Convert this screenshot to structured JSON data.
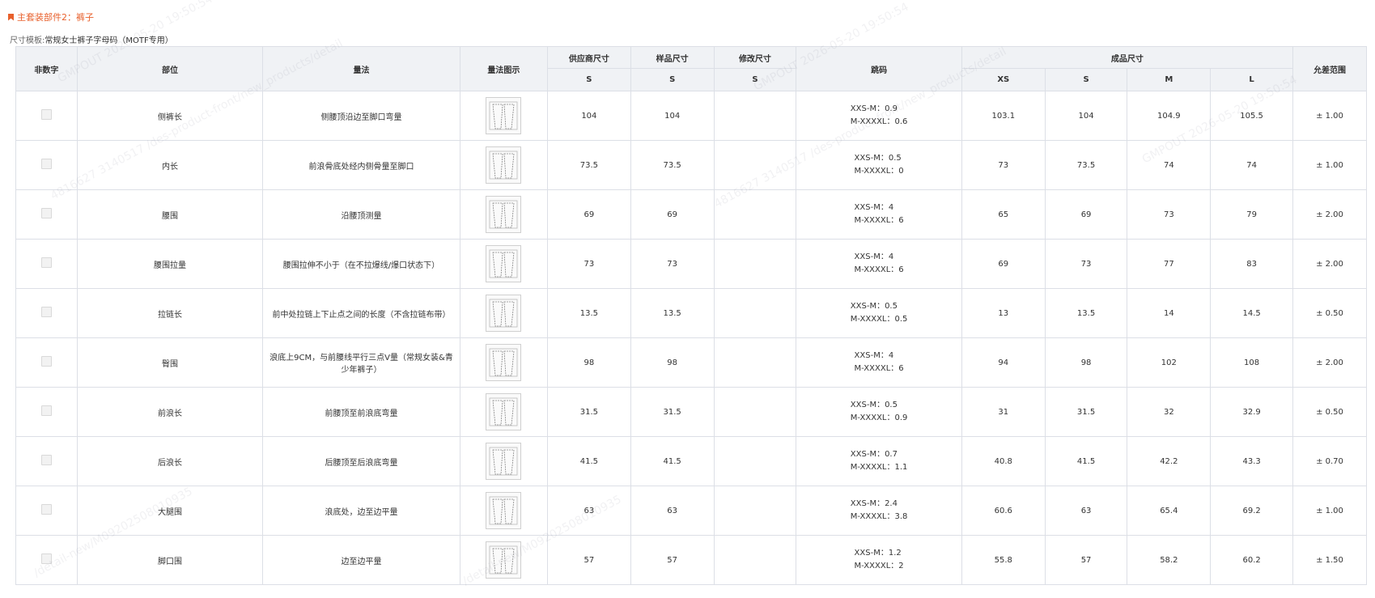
{
  "section": {
    "title": "主套装部件2：裤子"
  },
  "template": {
    "label": "尺寸模板:",
    "value": "常规女士裤子字母码（MOTF专用）"
  },
  "table": {
    "headers": {
      "non_numeric": "非数字",
      "part": "部位",
      "method": "量法",
      "diagram": "量法图示",
      "supplier_size": "供应商尺寸",
      "sample_size": "样品尺寸",
      "modified_size": "修改尺寸",
      "grading": "跳码",
      "finished_size": "成品尺寸",
      "tolerance": "允差范围"
    },
    "sub_headers": {
      "supplier": "S",
      "sample": "S",
      "modified": "S",
      "finished": [
        "XS",
        "S",
        "M",
        "L"
      ]
    },
    "rows": [
      {
        "part": "侧裤长",
        "method": "侧腰顶沿边至脚口弯量",
        "supplier": "104",
        "sample": "104",
        "modified": "",
        "grade1": "XXS-M：0.9",
        "grade2": "M-XXXXL：0.6",
        "xs": "103.1",
        "s": "104",
        "m": "104.9",
        "l": "105.5",
        "tol": "± 1.00"
      },
      {
        "part": "内长",
        "method": "前浪骨底处经内侧骨量至脚口",
        "supplier": "73.5",
        "sample": "73.5",
        "modified": "",
        "grade1": "XXS-M：0.5",
        "grade2": "M-XXXXL：0",
        "xs": "73",
        "s": "73.5",
        "m": "74",
        "l": "74",
        "tol": "± 1.00"
      },
      {
        "part": "腰围",
        "method": "沿腰顶测量",
        "supplier": "69",
        "sample": "69",
        "modified": "",
        "grade1": "XXS-M：4",
        "grade2": "M-XXXXL：6",
        "xs": "65",
        "s": "69",
        "m": "73",
        "l": "79",
        "tol": "± 2.00"
      },
      {
        "part": "腰围拉量",
        "method": "腰围拉伸不小于（在不拉爆线/爆口状态下）",
        "supplier": "73",
        "sample": "73",
        "modified": "",
        "grade1": "XXS-M：4",
        "grade2": "M-XXXXL：6",
        "xs": "69",
        "s": "73",
        "m": "77",
        "l": "83",
        "tol": "± 2.00"
      },
      {
        "part": "拉链长",
        "method": "前中处拉链上下止点之间的长度（不含拉链布带）",
        "supplier": "13.5",
        "sample": "13.5",
        "modified": "",
        "grade1": "XXS-M：0.5",
        "grade2": "M-XXXXL：0.5",
        "xs": "13",
        "s": "13.5",
        "m": "14",
        "l": "14.5",
        "tol": "± 0.50"
      },
      {
        "part": "臀围",
        "method": "浪底上9CM，与前腰线平行三点V量（常规女装&青少年裤子）",
        "supplier": "98",
        "sample": "98",
        "modified": "",
        "grade1": "XXS-M：4",
        "grade2": "M-XXXXL：6",
        "xs": "94",
        "s": "98",
        "m": "102",
        "l": "108",
        "tol": "± 2.00"
      },
      {
        "part": "前浪长",
        "method": "前腰顶至前浪底弯量",
        "supplier": "31.5",
        "sample": "31.5",
        "modified": "",
        "grade1": "XXS-M：0.5",
        "grade2": "M-XXXXL：0.9",
        "xs": "31",
        "s": "31.5",
        "m": "32",
        "l": "32.9",
        "tol": "± 0.50"
      },
      {
        "part": "后浪长",
        "method": "后腰顶至后浪底弯量",
        "supplier": "41.5",
        "sample": "41.5",
        "modified": "",
        "grade1": "XXS-M：0.7",
        "grade2": "M-XXXXL：1.1",
        "xs": "40.8",
        "s": "41.5",
        "m": "42.2",
        "l": "43.3",
        "tol": "± 0.70"
      },
      {
        "part": "大腿围",
        "method": "浪底处，边至边平量",
        "supplier": "63",
        "sample": "63",
        "modified": "",
        "grade1": "XXS-M：2.4",
        "grade2": "M-XXXXL：3.8",
        "xs": "60.6",
        "s": "63",
        "m": "65.4",
        "l": "69.2",
        "tol": "± 1.00"
      },
      {
        "part": "脚口围",
        "method": "边至边平量",
        "supplier": "57",
        "sample": "57",
        "modified": "",
        "grade1": "XXS-M：1.2",
        "grade2": "M-XXXXL：2",
        "xs": "55.8",
        "s": "57",
        "m": "58.2",
        "l": "60.2",
        "tol": "± 1.50"
      }
    ]
  },
  "watermarks": [
    "4816627 3140517 /des-product-front/new_products/detail",
    "GMPOUT 2026-05-20 19:50:54",
    "/detail-new/M09202508010935"
  ]
}
